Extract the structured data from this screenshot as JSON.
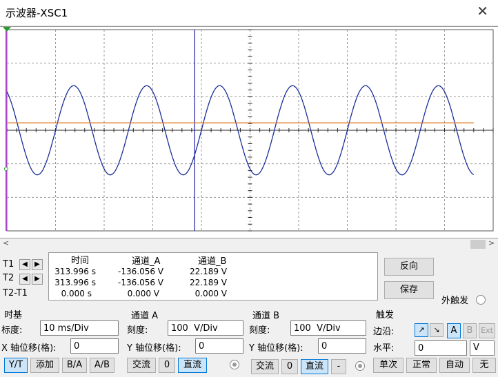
{
  "window": {
    "title": "示波器-XSC1",
    "close": "✕"
  },
  "readout": {
    "headers": {
      "time": "时间",
      "chA": "通道_A",
      "chB": "通道_B"
    },
    "rows": [
      {
        "label": "T1",
        "time": "313.996 s",
        "chA": "-136.056 V",
        "chB": "22.189 V"
      },
      {
        "label": "T2",
        "time": "313.996 s",
        "chA": "-136.056 V",
        "chB": "22.189 V"
      },
      {
        "label": "T2-T1",
        "time": "0.000 s",
        "chA": "0.000 V",
        "chB": "0.000 V"
      }
    ],
    "arrow_left": "◀",
    "arrow_right": "▶"
  },
  "buttons": {
    "reverse": "反向",
    "save": "保存",
    "ext_trigger": "外触发"
  },
  "timebase": {
    "title": "时基",
    "scale_label": "标度:",
    "scale": "10 ms/Div",
    "xpos_label": "X 轴位移(格):",
    "xpos": "0",
    "yt": "Y/T",
    "add": "添加",
    "ba": "B/A",
    "ab": "A/B"
  },
  "channel_a": {
    "title": "通道 A",
    "scale_label": "刻度:",
    "scale": "100  V/Div",
    "ypos_label": "Y 轴位移(格):",
    "ypos": "0",
    "ac": "交流",
    "zero": "0",
    "dc": "直流"
  },
  "channel_b": {
    "title": "通道 B",
    "scale_label": "刻度:",
    "scale": "100  V/Div",
    "ypos_label": "Y 轴位移(格):",
    "ypos": "0",
    "ac": "交流",
    "zero": "0",
    "dc": "直流",
    "minus": "-"
  },
  "trigger": {
    "title": "触发",
    "edge_label": "边沿:",
    "level_label": "水平:",
    "level": "0",
    "unit": "V",
    "rise": "↗",
    "fall": "↘",
    "a": "A",
    "b": "B",
    "ext": "Ext",
    "single": "单次",
    "normal": "正常",
    "auto": "自动",
    "none": "无"
  },
  "colors": {
    "channel_a": "#1a2f9a",
    "channel_b": "#e07820",
    "cursor": "#1a1aaa",
    "grid": "#999999"
  },
  "chart_data": {
    "type": "line",
    "series": [
      {
        "kind": "sine",
        "amplitude": 1.33,
        "offset": 0,
        "period_div": 1.5,
        "phase_div": -0.5,
        "start_div": 0,
        "end_div": 9.6,
        "color": "#1a2f9a"
      },
      {
        "kind": "dc",
        "offset": 0.22,
        "start_div": 0,
        "end_div": 9.6,
        "color": "#e07820"
      }
    ],
    "xlim": [
      0,
      10
    ],
    "ylim": [
      -3,
      3
    ],
    "cursor_x_div": 3.86
  }
}
